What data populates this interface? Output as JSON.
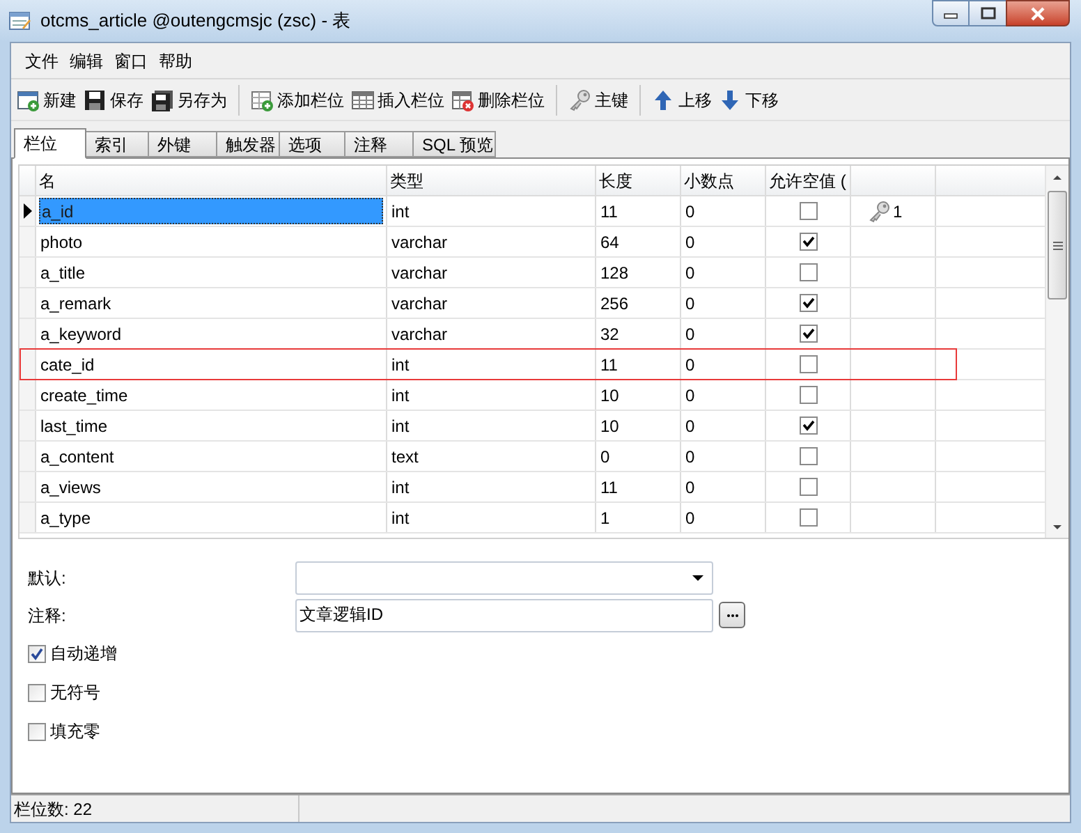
{
  "window": {
    "title": "otcms_article @outengcmsjc (zsc) - 表"
  },
  "menu": [
    "文件",
    "编辑",
    "窗口",
    "帮助"
  ],
  "toolbar": [
    {
      "kind": "new",
      "label": "新建"
    },
    {
      "kind": "save",
      "label": "保存"
    },
    {
      "kind": "saveas",
      "label": "另存为"
    },
    {
      "kind": "sep"
    },
    {
      "kind": "addcol",
      "label": "添加栏位"
    },
    {
      "kind": "insertcol",
      "label": "插入栏位"
    },
    {
      "kind": "deletecol",
      "label": "删除栏位"
    },
    {
      "kind": "sep"
    },
    {
      "kind": "key",
      "label": "主键"
    },
    {
      "kind": "sep"
    },
    {
      "kind": "up",
      "label": "上移"
    },
    {
      "kind": "down",
      "label": "下移"
    }
  ],
  "tabs": [
    {
      "label": "栏位",
      "selected": true
    },
    {
      "label": "索引",
      "selected": false
    },
    {
      "label": "外键",
      "selected": false
    },
    {
      "label": "触发器",
      "selected": false
    },
    {
      "label": "选项",
      "selected": false
    },
    {
      "label": "注释",
      "selected": false
    },
    {
      "label": "SQL 预览",
      "selected": false
    }
  ],
  "table": {
    "columns": [
      "名",
      "类型",
      "长度",
      "小数点",
      "允许空值 ("
    ],
    "rows": [
      {
        "name": "a_id",
        "type": "int",
        "length": "11",
        "decimals": "0",
        "nullable": false,
        "primary_key": "1",
        "selected": true,
        "outlined": false
      },
      {
        "name": "photo",
        "type": "varchar",
        "length": "64",
        "decimals": "0",
        "nullable": true,
        "selected": false,
        "outlined": false
      },
      {
        "name": "a_title",
        "type": "varchar",
        "length": "128",
        "decimals": "0",
        "nullable": false,
        "selected": false,
        "outlined": false
      },
      {
        "name": "a_remark",
        "type": "varchar",
        "length": "256",
        "decimals": "0",
        "nullable": true,
        "selected": false,
        "outlined": false
      },
      {
        "name": "a_keyword",
        "type": "varchar",
        "length": "32",
        "decimals": "0",
        "nullable": true,
        "selected": false,
        "outlined": false
      },
      {
        "name": "cate_id",
        "type": "int",
        "length": "11",
        "decimals": "0",
        "nullable": false,
        "selected": false,
        "outlined": true
      },
      {
        "name": "create_time",
        "type": "int",
        "length": "10",
        "decimals": "0",
        "nullable": false,
        "selected": false,
        "outlined": false
      },
      {
        "name": "last_time",
        "type": "int",
        "length": "10",
        "decimals": "0",
        "nullable": true,
        "selected": false,
        "outlined": false
      },
      {
        "name": "a_content",
        "type": "text",
        "length": "0",
        "decimals": "0",
        "nullable": false,
        "selected": false,
        "outlined": false
      },
      {
        "name": "a_views",
        "type": "int",
        "length": "11",
        "decimals": "0",
        "nullable": false,
        "selected": false,
        "outlined": false
      },
      {
        "name": "a_type",
        "type": "int",
        "length": "1",
        "decimals": "0",
        "nullable": false,
        "selected": false,
        "outlined": false
      }
    ]
  },
  "properties": {
    "default": {
      "label": "默认:"
    },
    "comment": {
      "label": "注释:",
      "value": "文章逻辑ID"
    },
    "options": [
      {
        "label": "自动递增",
        "checked": true
      },
      {
        "label": "无符号",
        "checked": false
      },
      {
        "label": "填充零",
        "checked": false
      }
    ]
  },
  "status_bar": "栏位数: 22"
}
